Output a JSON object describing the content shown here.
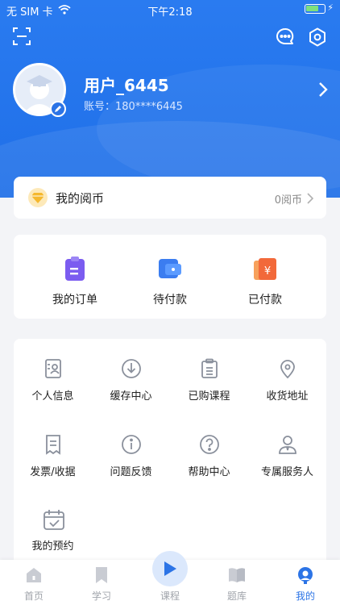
{
  "status_bar": {
    "carrier": "无 SIM 卡",
    "time": "下午2:18"
  },
  "profile": {
    "username": "用户_6445",
    "account": "账号：180****6445"
  },
  "coins": {
    "label": "我的阅币",
    "value": "0阅币"
  },
  "orders": [
    {
      "label": "我的订单",
      "icon": "order-list-icon"
    },
    {
      "label": "待付款",
      "icon": "wallet-icon"
    },
    {
      "label": "已付款",
      "icon": "paid-yuan-icon"
    }
  ],
  "services": [
    {
      "label": "个人信息",
      "icon": "id-card-icon"
    },
    {
      "label": "缓存中心",
      "icon": "download-icon"
    },
    {
      "label": "已购课程",
      "icon": "clipboard-icon"
    },
    {
      "label": "收货地址",
      "icon": "location-pin-icon"
    },
    {
      "label": "发票/收据",
      "icon": "receipt-icon"
    },
    {
      "label": "问题反馈",
      "icon": "info-icon"
    },
    {
      "label": "帮助中心",
      "icon": "help-icon"
    },
    {
      "label": "专属服务人",
      "icon": "service-person-icon"
    },
    {
      "label": "我的预约",
      "icon": "calendar-check-icon"
    }
  ],
  "tabs": [
    {
      "label": "首页",
      "icon": "home-icon"
    },
    {
      "label": "学习",
      "icon": "bookmark-icon"
    },
    {
      "label": "课程",
      "icon": "play-icon"
    },
    {
      "label": "题库",
      "icon": "book-icon"
    },
    {
      "label": "我的",
      "icon": "profile-icon"
    }
  ],
  "colors": {
    "primary": "#2C74E6",
    "hero": "#2479EE",
    "coin_gold": "#F5B82E",
    "order_purple": "#7B5CF0",
    "paid_orange": "#F2693A"
  }
}
